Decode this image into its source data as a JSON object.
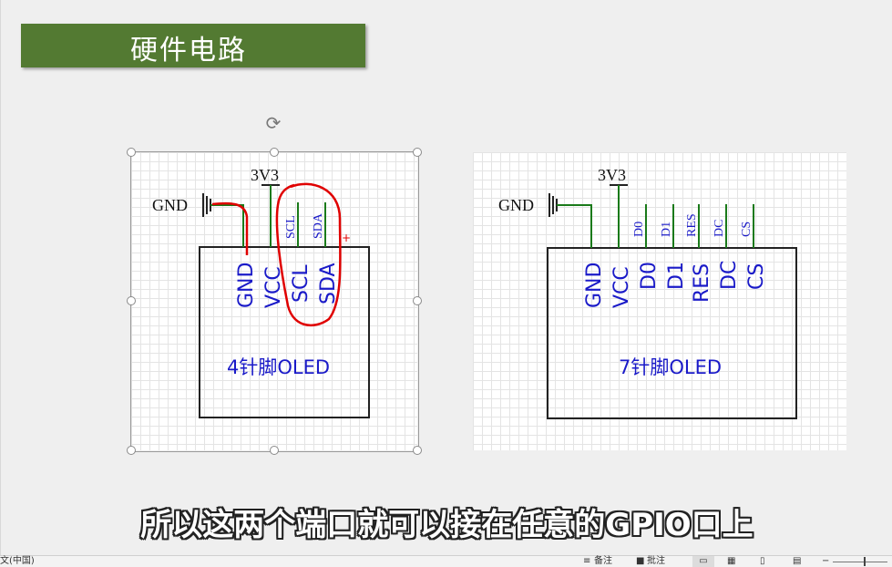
{
  "slide": {
    "title": "硬件电路",
    "subtitle": "所以这两个端口就可以接在任意的GPIO口上"
  },
  "left_diagram": {
    "module_label": "4针脚OLED",
    "power_label": "3V3",
    "ground_label": "GND",
    "top_pins": [
      "SCL",
      "SDA"
    ],
    "pins": [
      "GND",
      "VCC",
      "SCL",
      "SDA"
    ]
  },
  "right_diagram": {
    "module_label": "7针脚OLED",
    "power_label": "3V3",
    "ground_label": "GND",
    "top_pins": [
      "D0",
      "D1",
      "RES",
      "DC",
      "CS"
    ],
    "pins": [
      "GND",
      "VCC",
      "D0",
      "D1",
      "RES",
      "DC",
      "CS"
    ]
  },
  "status_bar": {
    "language": "文(中国)",
    "notes": "备注",
    "comments": "批注"
  },
  "colors": {
    "title_bg": "#537a32",
    "wire": "#1a7a1a",
    "label_blue": "#1a1ac8",
    "annotation_red": "#e00000"
  }
}
